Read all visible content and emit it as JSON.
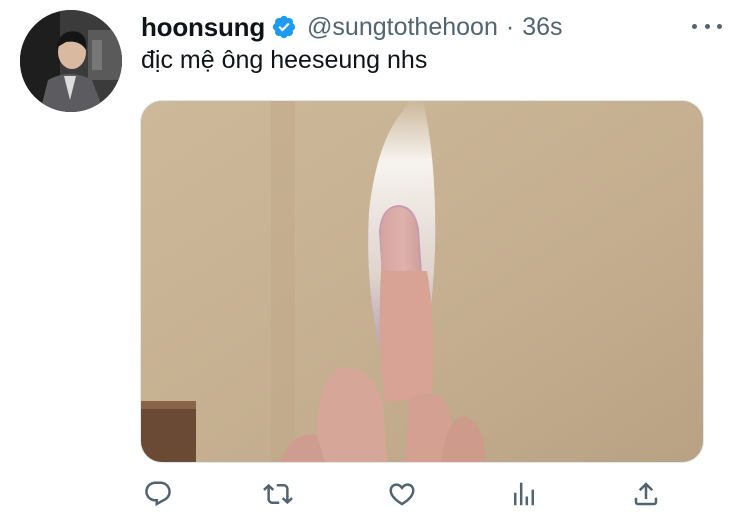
{
  "tweet": {
    "display_name": "hoonsung",
    "handle": "@sungtothehoon",
    "separator": "·",
    "timestamp": "36s",
    "text": "địc mệ ông heeseung nhs",
    "verified": true
  },
  "icons": {
    "verified": "verified-badge-icon",
    "more": "more-options-icon",
    "reply": "reply-icon",
    "retweet": "retweet-icon",
    "like": "like-icon",
    "analytics": "analytics-icon",
    "share": "share-icon"
  },
  "colors": {
    "text_primary": "#0f1419",
    "text_secondary": "#536471",
    "verified_blue": "#1d9bf0"
  }
}
